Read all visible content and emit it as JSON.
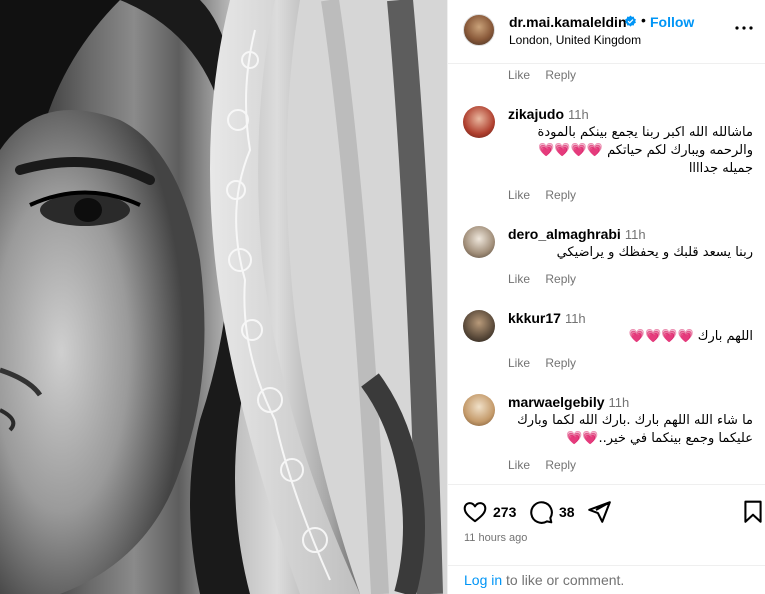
{
  "post": {
    "username": "dr.mai.kamaleldin",
    "follow_label": "Follow",
    "dot": "•",
    "location": "London, United Kingdom",
    "more_icon": "more-horizontal-icon",
    "verified_icon": "verified-badge-icon"
  },
  "comments": {
    "first_actions": {
      "like": "Like",
      "reply": "Reply"
    },
    "items": [
      {
        "username": "zikajudo",
        "time": "11h",
        "text": "ماشالله الله اكبر ربنا يجمع بينكم بالمودة والرحمه ويبارك لكم حياتكم 💗💗💗💗 جميله جداااا",
        "like": "Like",
        "reply": "Reply"
      },
      {
        "username": "dero_almaghrabi",
        "time": "11h",
        "text": "ربنا يسعد قلبك و يحفظك و يراضيكي",
        "like": "Like",
        "reply": "Reply"
      },
      {
        "username": "kkkur17",
        "time": "11h",
        "text": "اللهم بارك 💗💗💗💗",
        "like": "Like",
        "reply": "Reply"
      },
      {
        "username": "marwaelgebily",
        "time": "11h",
        "text": "ما شاء الله اللهم بارك .بارك الله لكما وبارك عليكما وجمع بينكما في خير..💗💗",
        "like": "Like",
        "reply": "Reply"
      }
    ]
  },
  "footer": {
    "likes": "273",
    "comments": "38",
    "time_ago": "11 hours ago",
    "login_link": "Log in",
    "login_suffix": " to like or comment."
  },
  "colors": {
    "accent": "#0095f6",
    "secondary_text": "#737373",
    "divider": "#efefef"
  }
}
